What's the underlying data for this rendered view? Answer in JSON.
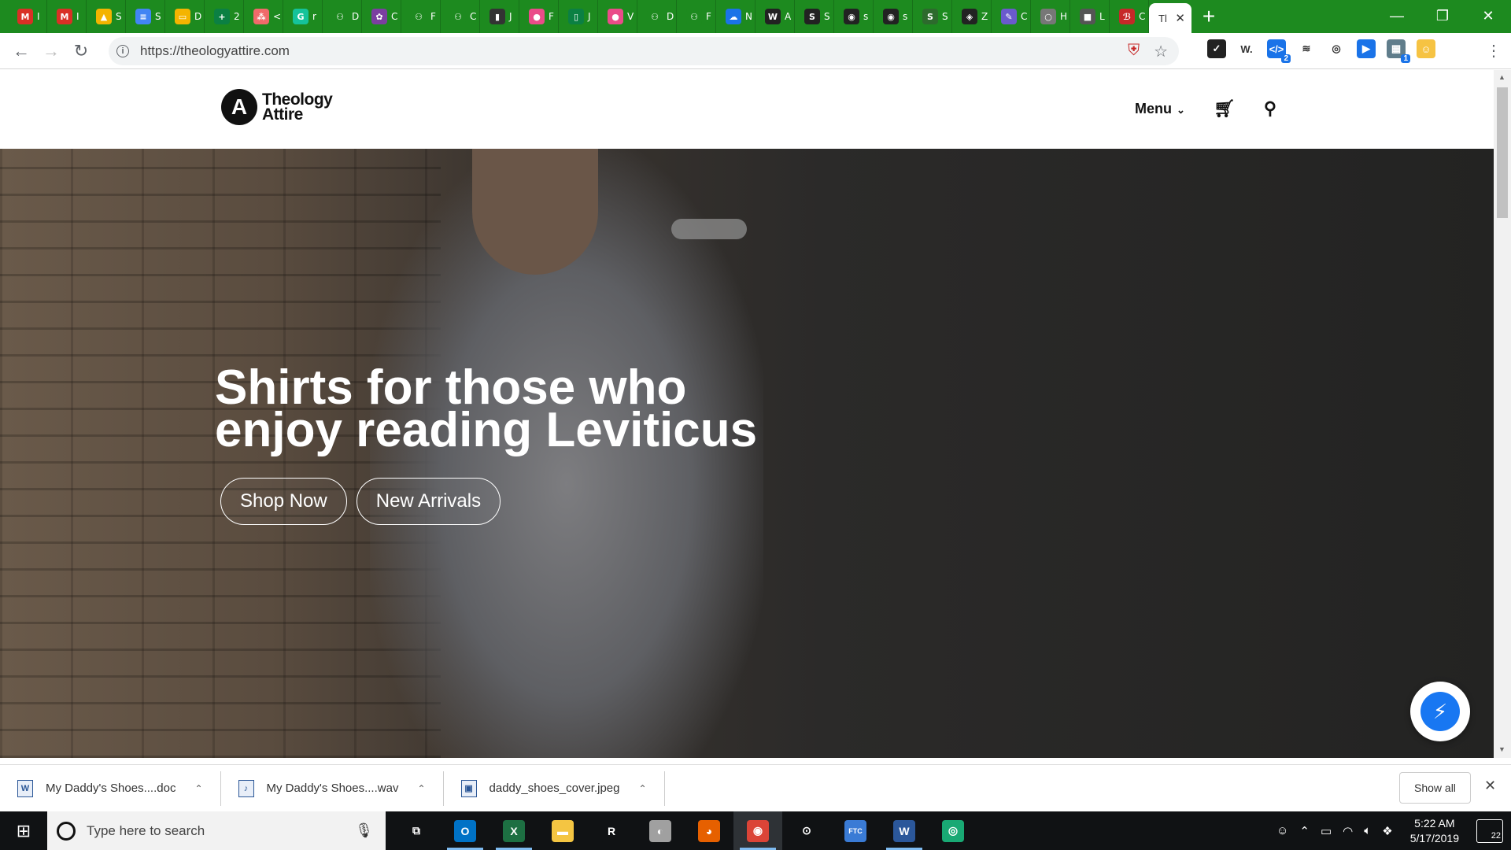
{
  "browser": {
    "tabs_mini": [
      {
        "icon": "gmail-icon",
        "color": "#d93025",
        "glyph": "M",
        "label": "I"
      },
      {
        "icon": "gmail-icon",
        "color": "#d93025",
        "glyph": "M",
        "label": "I"
      },
      {
        "icon": "google-drive-icon",
        "color": "#f4b400",
        "glyph": "▲",
        "label": "S"
      },
      {
        "icon": "google-docs-icon",
        "color": "#4285f4",
        "glyph": "≡",
        "label": "S"
      },
      {
        "icon": "google-slides-icon",
        "color": "#f4b400",
        "glyph": "▭",
        "label": "D"
      },
      {
        "icon": "plus-app-icon",
        "color": "#0b8043",
        "glyph": "+",
        "label": "2"
      },
      {
        "icon": "asana-icon",
        "color": "#f06a6a",
        "glyph": "⁂",
        "label": "<"
      },
      {
        "icon": "grammarly-icon",
        "color": "#15c39a",
        "glyph": "G",
        "label": "r"
      },
      {
        "icon": "person-icon",
        "color": "#1d8a1f",
        "glyph": "⚇",
        "label": "D"
      },
      {
        "icon": "flower-icon",
        "color": "#7b3fa0",
        "glyph": "✿",
        "label": "C"
      },
      {
        "icon": "person-icon",
        "color": "#1d8a1f",
        "glyph": "⚇",
        "label": "F"
      },
      {
        "icon": "person-icon",
        "color": "#1d8a1f",
        "glyph": "⚇",
        "label": "C"
      },
      {
        "icon": "badge-icon",
        "color": "#333333",
        "glyph": "▮",
        "label": "J"
      },
      {
        "icon": "dribbble-icon",
        "color": "#ea4c89",
        "glyph": "●",
        "label": "F"
      },
      {
        "icon": "phone-icon",
        "color": "#0b8043",
        "glyph": "▯",
        "label": "J"
      },
      {
        "icon": "dribbble-icon",
        "color": "#ea4c89",
        "glyph": "●",
        "label": "V"
      },
      {
        "icon": "person-icon",
        "color": "#1d8a1f",
        "glyph": "⚇",
        "label": "D"
      },
      {
        "icon": "person-icon",
        "color": "#1d8a1f",
        "glyph": "⚇",
        "label": "F"
      },
      {
        "icon": "cloud-icon",
        "color": "#1a73e8",
        "glyph": "☁",
        "label": "N"
      },
      {
        "icon": "w-logo-icon",
        "color": "#222222",
        "glyph": "W",
        "label": "A"
      },
      {
        "icon": "s-logo-icon",
        "color": "#222222",
        "glyph": "S",
        "label": "S"
      },
      {
        "icon": "github-icon",
        "color": "#222222",
        "glyph": "◉",
        "label": "s"
      },
      {
        "icon": "github-icon",
        "color": "#222222",
        "glyph": "◉",
        "label": "s"
      },
      {
        "icon": "s-logo-icon",
        "color": "#2d6a2d",
        "glyph": "S",
        "label": "S"
      },
      {
        "icon": "codepen-icon",
        "color": "#222222",
        "glyph": "◈",
        "label": "Z"
      },
      {
        "icon": "pencil-icon",
        "color": "#6a5acd",
        "glyph": "✎",
        "label": "C"
      },
      {
        "icon": "circle-icon",
        "color": "#777777",
        "glyph": "○",
        "label": "H"
      },
      {
        "icon": "box-icon",
        "color": "#555555",
        "glyph": "■",
        "label": "L"
      },
      {
        "icon": "red-logo-icon",
        "color": "#c62828",
        "glyph": "ℬ",
        "label": "C"
      }
    ],
    "active_tab_label": "Tl",
    "new_tab_symbol": "+",
    "window_controls": [
      "—",
      "❐",
      "✕"
    ],
    "url": "https://theologyattire.com"
  },
  "extensions": [
    {
      "icon": "checkbox-ext-icon",
      "color": "#222222",
      "glyph": "✓",
      "badge": ""
    },
    {
      "icon": "w-ext-icon",
      "color": "#ffffff",
      "glyph": "W.",
      "badge": ""
    },
    {
      "icon": "code-ext-icon",
      "color": "#1a73e8",
      "glyph": "</>",
      "badge": "2"
    },
    {
      "icon": "layers-ext-icon",
      "color": "#ffffff",
      "glyph": "≋",
      "badge": ""
    },
    {
      "icon": "spiral-ext-icon",
      "color": "#ffffff",
      "glyph": "◎",
      "badge": ""
    },
    {
      "icon": "flag-ext-icon",
      "color": "#1a73e8",
      "glyph": "▶",
      "badge": ""
    },
    {
      "icon": "grid-ext-icon",
      "color": "#607d8b",
      "glyph": "▦",
      "badge": "1"
    },
    {
      "icon": "emoji-ext-icon",
      "color": "#f6c343",
      "glyph": "☺",
      "badge": ""
    }
  ],
  "site": {
    "logo_line1": "Theology",
    "logo_line2": "Attire",
    "logo_mark": "A",
    "menu_label": "Menu",
    "hero_title_line1": "Shirts for those who",
    "hero_title_line2": "enjoy reading Leviticus",
    "shop_now": "Shop Now",
    "new_arrivals": "New Arrivals"
  },
  "downloads": [
    {
      "name": "My Daddy's Shoes....doc",
      "icon": "W"
    },
    {
      "name": "My Daddy's Shoes....wav",
      "icon": "♪"
    },
    {
      "name": "daddy_shoes_cover.jpeg",
      "icon": "▣"
    }
  ],
  "downloads_show_all": "Show all",
  "taskbar": {
    "search_placeholder": "Type here to search",
    "apps": [
      {
        "icon": "task-view-icon",
        "color": "#101214",
        "glyph": "⧉",
        "state": ""
      },
      {
        "icon": "outlook-icon",
        "color": "#0072c6",
        "glyph": "O",
        "state": "running"
      },
      {
        "icon": "excel-icon",
        "color": "#1d6f42",
        "glyph": "X",
        "state": "running"
      },
      {
        "icon": "file-explorer-icon",
        "color": "#f4c542",
        "glyph": "▬",
        "state": ""
      },
      {
        "icon": "r-app-icon",
        "color": "#101214",
        "glyph": "R",
        "state": ""
      },
      {
        "icon": "paint-icon",
        "color": "#a0a0a0",
        "glyph": "◐",
        "state": ""
      },
      {
        "icon": "firefox-icon",
        "color": "#e66000",
        "glyph": "◕",
        "state": ""
      },
      {
        "icon": "chrome-icon",
        "color": "#db4437",
        "glyph": "◉",
        "state": "active"
      },
      {
        "icon": "target-app-icon",
        "color": "#101214",
        "glyph": "⊙",
        "state": ""
      },
      {
        "icon": "ftc-icon",
        "color": "#3a7bd5",
        "glyph": "FTC",
        "state": ""
      },
      {
        "icon": "word-icon",
        "color": "#2b579a",
        "glyph": "W",
        "state": "running"
      },
      {
        "icon": "green-circle-icon",
        "color": "#19a974",
        "glyph": "◎",
        "state": ""
      }
    ],
    "time": "5:22 AM",
    "date": "5/17/2019",
    "notifications": "22"
  }
}
